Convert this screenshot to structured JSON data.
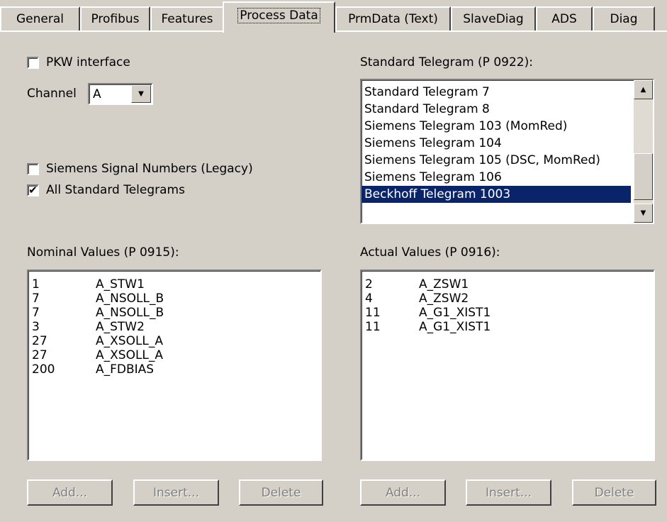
{
  "tabs": [
    {
      "label": "General"
    },
    {
      "label": "Profibus"
    },
    {
      "label": "Features"
    },
    {
      "label": "Process Data",
      "active": true
    },
    {
      "label": "PrmData (Text)"
    },
    {
      "label": "SlaveDiag"
    },
    {
      "label": "ADS"
    },
    {
      "label": "Diag"
    }
  ],
  "pkw": {
    "label": "PKW interface",
    "checked": false
  },
  "channel": {
    "label": "Channel",
    "value": "A"
  },
  "siemens_signals": {
    "label": "Siemens Signal Numbers (Legacy)",
    "checked": false
  },
  "all_telegrams": {
    "label": "All Standard Telegrams",
    "checked": true,
    "mark": "✔"
  },
  "standard_telegram": {
    "label": "Standard Telegram (P 0922):",
    "items": [
      "Standard Telegram 7",
      "Standard Telegram 8",
      "Siemens Telegram 103 (MomRed)",
      "Siemens Telegram 104",
      "Siemens Telegram 105 (DSC, MomRed)",
      "Siemens Telegram 106",
      "Beckhoff Telegram 1003"
    ],
    "selected": "Beckhoff Telegram 1003"
  },
  "nominal": {
    "label": "Nominal Values (P 0915):",
    "rows": [
      {
        "num": "1",
        "name": "A_STW1"
      },
      {
        "num": "7",
        "name": "A_NSOLL_B"
      },
      {
        "num": "7",
        "name": "A_NSOLL_B"
      },
      {
        "num": "3",
        "name": "A_STW2"
      },
      {
        "num": "27",
        "name": "A_XSOLL_A"
      },
      {
        "num": "27",
        "name": "A_XSOLL_A"
      },
      {
        "num": "200",
        "name": "A_FDBIAS"
      }
    ],
    "buttons": {
      "add": "Add...",
      "insert": "Insert...",
      "delete": "Delete"
    }
  },
  "actual": {
    "label": "Actual Values (P 0916):",
    "rows": [
      {
        "num": "2",
        "name": "A_ZSW1"
      },
      {
        "num": "4",
        "name": "A_ZSW2"
      },
      {
        "num": "11",
        "name": "A_G1_XIST1"
      },
      {
        "num": "11",
        "name": "A_G1_XIST1"
      }
    ],
    "buttons": {
      "add": "Add...",
      "insert": "Insert...",
      "delete": "Delete"
    }
  },
  "icons": {
    "dropdown": "chevron-down-icon",
    "scroll_up": "scroll-up-arrow-icon",
    "scroll_down": "scroll-down-arrow-icon"
  },
  "colors": {
    "face": "#d4d0c8",
    "selection": "#0a246a"
  }
}
